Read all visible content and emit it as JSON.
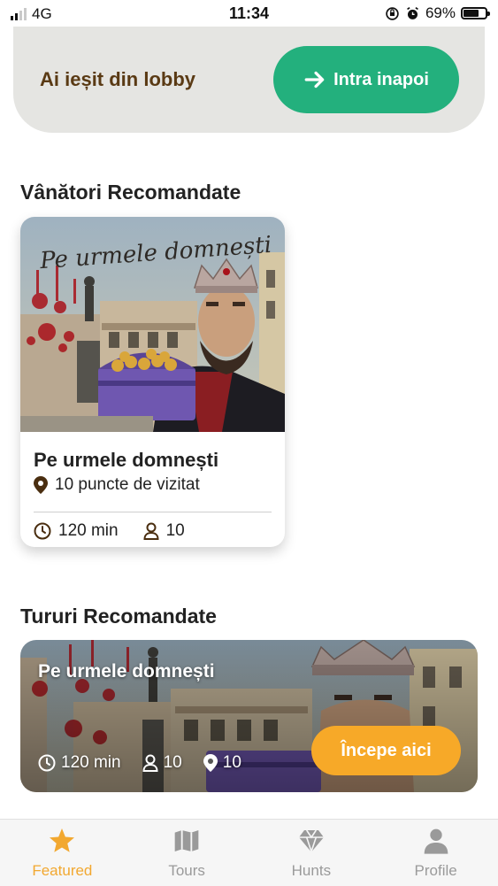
{
  "status_bar": {
    "carrier": "4G",
    "time": "11:34",
    "battery": "69%",
    "battery_level": 0.69
  },
  "lobby": {
    "message": "Ai ieșit din lobby",
    "rejoin_label": "Intra inapoi"
  },
  "sections": {
    "hunts_title": "Vânători Recomandate",
    "tours_title": "Tururi Recomandate"
  },
  "hunt_card": {
    "image_caption": "Pe urmele domnești",
    "title": "Pe urmele domnești",
    "points": "10 puncte de vizitat",
    "duration": "120 min",
    "players": "10"
  },
  "tour_card": {
    "title": "Pe urmele domnești",
    "duration": "120 min",
    "players": "10",
    "points": "10",
    "start_label": "Începe aici"
  },
  "nav": {
    "items": [
      {
        "label": "Featured",
        "icon": "star-icon",
        "active": true
      },
      {
        "label": "Tours",
        "icon": "map-icon",
        "active": false
      },
      {
        "label": "Hunts",
        "icon": "diamond-icon",
        "active": false
      },
      {
        "label": "Profile",
        "icon": "person-icon",
        "active": false
      }
    ]
  },
  "colors": {
    "accent_green": "#23b07d",
    "accent_orange": "#f7a928",
    "brown": "#5a3a14",
    "nav_active": "#f2a830",
    "nav_inactive": "#9a9a9a"
  }
}
